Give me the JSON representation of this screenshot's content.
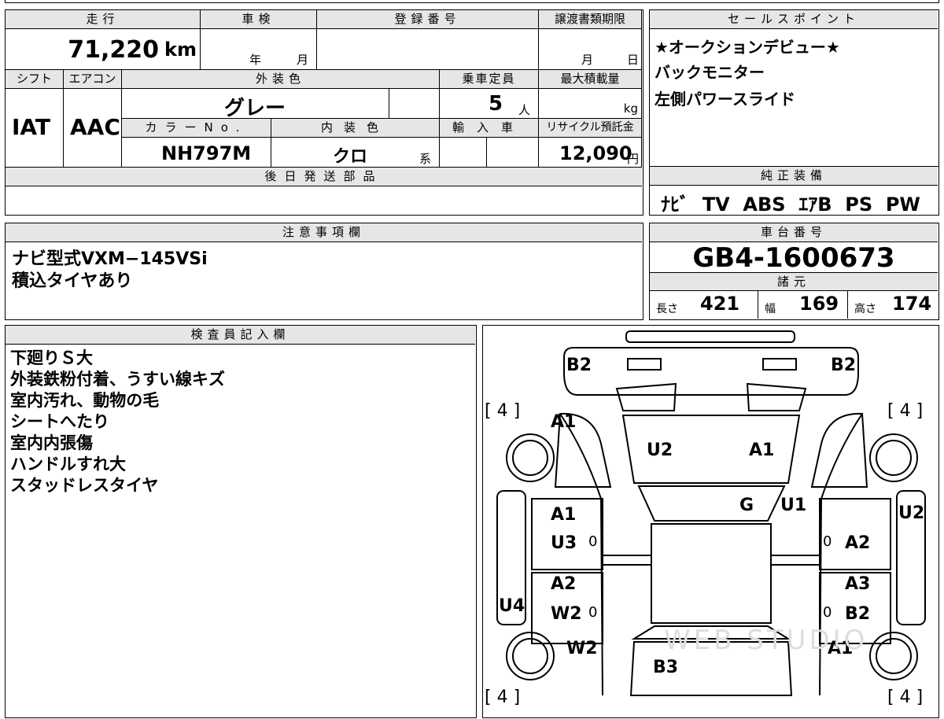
{
  "top_labels": {
    "mileage": "走行",
    "shaken": "車検",
    "registration": "登録番号",
    "transfer_deadline": "譲渡書類期限",
    "sales_points": "セールスポイント",
    "shift": "シフト",
    "aircon": "エアコン",
    "exterior_color": "外装色",
    "capacity": "乗車定員",
    "max_load": "最大積載量",
    "color_no": "カラーNo.",
    "interior_color": "内装色",
    "import": "輸入車",
    "recycle": "リサイクル預託金",
    "later_parts": "後日発送部品",
    "genuine_equipment": "純正装備",
    "notes": "注意事項欄",
    "chassis": "車台番号",
    "specs": "諸元",
    "inspector": "検査員記入欄"
  },
  "values": {
    "mileage": "71,220",
    "mileage_unit": "km",
    "shaken_year": "年",
    "shaken_month": "月",
    "deadline_month": "月",
    "deadline_day": "日",
    "shift": "IAT",
    "aircon": "AAC",
    "exterior_color": "グレー",
    "capacity": "5",
    "capacity_unit": "人",
    "max_load_unit": "kg",
    "color_no": "NH797M",
    "interior_color": "クロ",
    "interior_suffix": "系",
    "recycle": "12,090",
    "recycle_unit": "円",
    "genuine_equipment": "ﾅﾋﾞ  TV  ABS  ｴｱB  PS  PW",
    "chassis": "GB4-1600673",
    "length_label": "長さ",
    "length": "421",
    "width_label": "幅",
    "width": "169",
    "height_label": "高さ",
    "height": "174"
  },
  "sales_points": [
    "★オークションデビュー★",
    "バックモニター",
    "左側パワースライド"
  ],
  "notes": [
    "ナビ型式VXM−145VSi",
    "積込タイヤあり"
  ],
  "inspector_notes": [
    "下廻りＳ大",
    "外装鉄粉付着、うすい線キズ",
    "室内汚れ、動物の毛",
    "シートへたり",
    "室内内張傷",
    "ハンドルすれ大",
    "スタッドレスタイヤ"
  ],
  "diagram": {
    "b2_left": "B2",
    "b2_right": "B2",
    "tire_fl": "[ 4 ]",
    "tire_fr": "[ 4 ]",
    "tire_rl": "[ 4 ]",
    "tire_rr": "[ 4 ]",
    "a1_front_left": "A1",
    "u2_hood": "U2",
    "a1_hood": "A1",
    "g_glass": "G",
    "u1_pillar": "U1",
    "u2_right_fender": "U2",
    "a1_left_door": "A1",
    "u3_left_door": "U3",
    "a2_right_door": "A2",
    "a2_left_rear": "A2",
    "w2_left_rear": "W2",
    "u4_left_sill": "U4",
    "a3_right_rear": "A3",
    "b2_right_rear": "B2",
    "w2_left_quarter": "W2",
    "a1_right_quarter": "A1",
    "b3_rear": "B3",
    "zero_1": "0",
    "zero_2": "0",
    "zero_3": "0",
    "zero_4": "0",
    "watermark": "WEB STUDIO"
  }
}
